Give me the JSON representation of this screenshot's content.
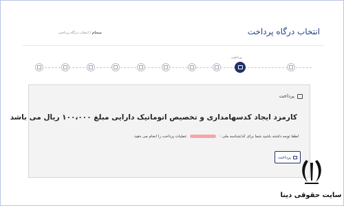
{
  "header": {
    "title": "انتخاب درگاه پرداخت",
    "breadcrumb": {
      "current": "سجام",
      "separator": "/",
      "page": "انتخاب درگاه پرداخت"
    }
  },
  "steps": {
    "active_label": "پرداخت",
    "icons": [
      "clipboard-icon",
      "card-icon",
      "image-icon",
      "document-icon",
      "help-icon",
      "bank-icon",
      "briefcase-icon",
      "person-icon",
      "payment-icon",
      "info-icon"
    ]
  },
  "card": {
    "heading": "پرداخت",
    "title": "کارمزد ایجاد کدسهامداری و تخصیص اتوماتیک دارایی مبلغ ۱۰۰،۰۰۰ ریال می باشد",
    "note_before": "لطفا توجه داشته باشید شما برای کد/شناسه ملی :",
    "note_after": "عملیات پرداخت را انجام می دهید.",
    "pay_button": "پرداخت"
  },
  "watermark": {
    "text": "سایت حقوقی دینا"
  },
  "colors": {
    "primary": "#20316b",
    "accent": "#1f3f86",
    "card_bg": "#f3f3f3"
  }
}
